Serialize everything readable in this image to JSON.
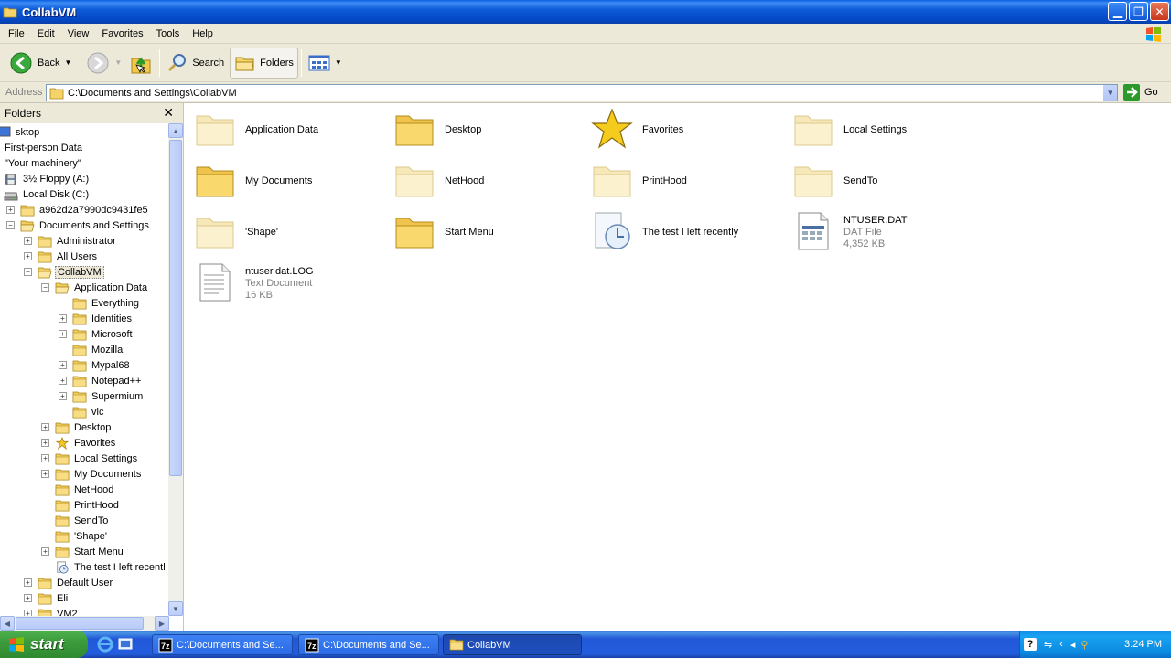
{
  "window": {
    "title": "CollabVM"
  },
  "menubar": {
    "items": [
      "File",
      "Edit",
      "View",
      "Favorites",
      "Tools",
      "Help"
    ]
  },
  "toolbar": {
    "back_label": "Back",
    "search_label": "Search",
    "folders_label": "Folders"
  },
  "address": {
    "label": "Address",
    "value": "C:\\Documents and Settings\\CollabVM",
    "go_label": "Go"
  },
  "folders_pane": {
    "header": "Folders",
    "tree": [
      {
        "label": "sktop",
        "icon": "desktop-icon",
        "indent": 0,
        "expander": ""
      },
      {
        "label": "First-person Data",
        "icon": "none",
        "indent": 0,
        "expander": ""
      },
      {
        "label": "\"Your machinery\"",
        "icon": "none",
        "indent": 0,
        "expander": ""
      },
      {
        "label": "3½ Floppy (A:)",
        "icon": "floppy-icon",
        "indent": 0,
        "expander": ""
      },
      {
        "label": "Local Disk (C:)",
        "icon": "drive-icon",
        "indent": 0,
        "expander": ""
      },
      {
        "label": "a962d2a7990dc9431fe5",
        "icon": "folder-icon",
        "indent": 1,
        "expander": "+"
      },
      {
        "label": "Documents and Settings",
        "icon": "folder-open-icon",
        "indent": 1,
        "expander": "-"
      },
      {
        "label": "Administrator",
        "icon": "folder-icon",
        "indent": 2,
        "expander": "+"
      },
      {
        "label": "All Users",
        "icon": "folder-icon",
        "indent": 2,
        "expander": "+"
      },
      {
        "label": "CollabVM",
        "icon": "folder-open-icon",
        "indent": 2,
        "expander": "-",
        "selected": true
      },
      {
        "label": "Application Data",
        "icon": "folder-open-icon",
        "indent": 3,
        "expander": "-"
      },
      {
        "label": "Everything",
        "icon": "folder-icon",
        "indent": 4,
        "expander": ""
      },
      {
        "label": "Identities",
        "icon": "folder-icon",
        "indent": 4,
        "expander": "+"
      },
      {
        "label": "Microsoft",
        "icon": "folder-icon",
        "indent": 4,
        "expander": "+"
      },
      {
        "label": "Mozilla",
        "icon": "folder-icon",
        "indent": 4,
        "expander": ""
      },
      {
        "label": "Mypal68",
        "icon": "folder-icon",
        "indent": 4,
        "expander": "+"
      },
      {
        "label": "Notepad++",
        "icon": "folder-icon",
        "indent": 4,
        "expander": "+"
      },
      {
        "label": "Supermium",
        "icon": "folder-icon",
        "indent": 4,
        "expander": "+"
      },
      {
        "label": "vlc",
        "icon": "folder-icon",
        "indent": 4,
        "expander": ""
      },
      {
        "label": "Desktop",
        "icon": "folder-icon",
        "indent": 3,
        "expander": "+"
      },
      {
        "label": "Favorites",
        "icon": "star-icon",
        "indent": 3,
        "expander": "+"
      },
      {
        "label": "Local Settings",
        "icon": "folder-icon",
        "indent": 3,
        "expander": "+"
      },
      {
        "label": "My Documents",
        "icon": "folder-icon",
        "indent": 3,
        "expander": "+"
      },
      {
        "label": "NetHood",
        "icon": "folder-icon",
        "indent": 3,
        "expander": ""
      },
      {
        "label": "PrintHood",
        "icon": "folder-icon",
        "indent": 3,
        "expander": ""
      },
      {
        "label": "SendTo",
        "icon": "folder-icon",
        "indent": 3,
        "expander": ""
      },
      {
        "label": "'Shape'",
        "icon": "folder-icon",
        "indent": 3,
        "expander": ""
      },
      {
        "label": "Start Menu",
        "icon": "folder-icon",
        "indent": 3,
        "expander": "+"
      },
      {
        "label": "The test I left recentl",
        "icon": "history-icon",
        "indent": 3,
        "expander": ""
      },
      {
        "label": "Default User",
        "icon": "folder-icon",
        "indent": 2,
        "expander": "+"
      },
      {
        "label": "Eli",
        "icon": "folder-icon",
        "indent": 2,
        "expander": "+"
      },
      {
        "label": "VM2",
        "icon": "folder-icon",
        "indent": 2,
        "expander": "+"
      }
    ]
  },
  "content": {
    "items": [
      {
        "name": "Application Data",
        "type": "",
        "size": "",
        "icon": "folder-faded-icon"
      },
      {
        "name": "Desktop",
        "type": "",
        "size": "",
        "icon": "folder-icon"
      },
      {
        "name": "Favorites",
        "type": "",
        "size": "",
        "icon": "star-icon"
      },
      {
        "name": "Local Settings",
        "type": "",
        "size": "",
        "icon": "folder-faded-icon"
      },
      {
        "name": "My Documents",
        "type": "",
        "size": "",
        "icon": "folder-icon"
      },
      {
        "name": "NetHood",
        "type": "",
        "size": "",
        "icon": "folder-faded-icon"
      },
      {
        "name": "PrintHood",
        "type": "",
        "size": "",
        "icon": "folder-faded-icon"
      },
      {
        "name": "SendTo",
        "type": "",
        "size": "",
        "icon": "folder-faded-icon"
      },
      {
        "name": "'Shape'",
        "type": "",
        "size": "",
        "icon": "folder-faded-icon"
      },
      {
        "name": "Start Menu",
        "type": "",
        "size": "",
        "icon": "folder-icon"
      },
      {
        "name": "The test I left recently",
        "type": "",
        "size": "",
        "icon": "history-icon"
      },
      {
        "name": "NTUSER.DAT",
        "type": "DAT File",
        "size": "4,352 KB",
        "icon": "dat-file-icon"
      },
      {
        "name": "ntuser.dat.LOG",
        "type": "Text Document",
        "size": "16 KB",
        "icon": "text-file-icon"
      }
    ]
  },
  "taskbar": {
    "start_label": "start",
    "tasks": [
      {
        "label": "C:\\Documents and Se...",
        "icon": "7zip-icon",
        "active": false
      },
      {
        "label": "C:\\Documents and Se...",
        "icon": "7zip-icon",
        "active": false
      },
      {
        "label": "CollabVM",
        "icon": "folder-icon",
        "active": true
      }
    ],
    "clock": "3:24 PM"
  },
  "colors": {
    "titlebar": "#0a5fe0",
    "chrome": "#ece9d8",
    "taskbar": "#2157d7",
    "start": "#3c9b3c",
    "tray": "#0f8ce9"
  }
}
